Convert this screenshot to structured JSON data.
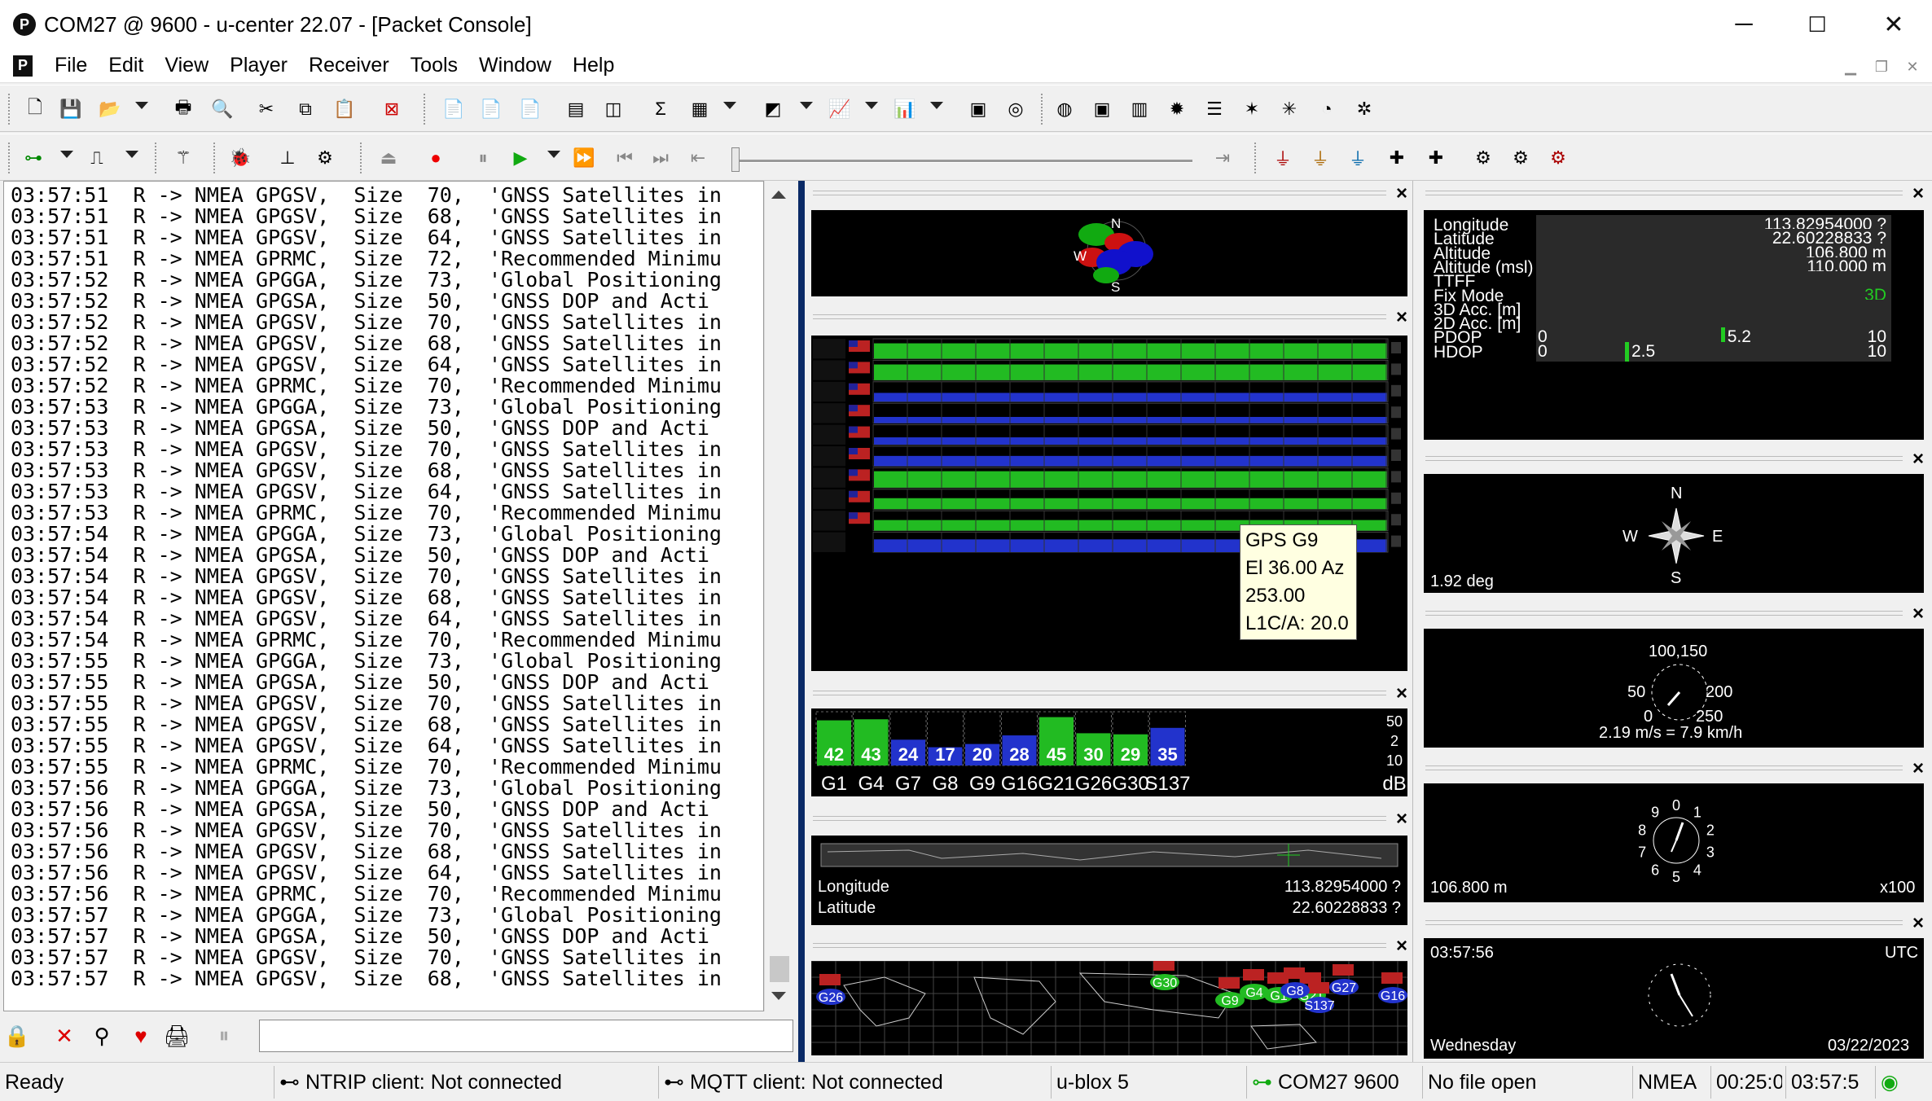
{
  "window": {
    "title": "COM27 @ 9600 - u-center 22.07 - [Packet Console]",
    "app_icon": "P",
    "minimize": "─",
    "maximize": "☐",
    "close": "✕"
  },
  "menu": {
    "doc_icon": "P",
    "items": [
      "File",
      "Edit",
      "View",
      "Player",
      "Receiver",
      "Tools",
      "Window",
      "Help"
    ]
  },
  "console": {
    "lines": [
      "03:57:51  R -> NMEA GPGSV,  Size  70,  'GNSS Satellites in",
      "03:57:51  R -> NMEA GPGSV,  Size  68,  'GNSS Satellites in",
      "03:57:51  R -> NMEA GPGSV,  Size  64,  'GNSS Satellites in",
      "03:57:51  R -> NMEA GPRMC,  Size  72,  'Recommended Minimu",
      "03:57:52  R -> NMEA GPGGA,  Size  73,  'Global Positioning",
      "03:57:52  R -> NMEA GPGSA,  Size  50,  'GNSS DOP and Acti",
      "03:57:52  R -> NMEA GPGSV,  Size  70,  'GNSS Satellites in",
      "03:57:52  R -> NMEA GPGSV,  Size  68,  'GNSS Satellites in",
      "03:57:52  R -> NMEA GPGSV,  Size  64,  'GNSS Satellites in",
      "03:57:52  R -> NMEA GPRMC,  Size  70,  'Recommended Minimu",
      "03:57:53  R -> NMEA GPGGA,  Size  73,  'Global Positioning",
      "03:57:53  R -> NMEA GPGSA,  Size  50,  'GNSS DOP and Acti",
      "03:57:53  R -> NMEA GPGSV,  Size  70,  'GNSS Satellites in",
      "03:57:53  R -> NMEA GPGSV,  Size  68,  'GNSS Satellites in",
      "03:57:53  R -> NMEA GPGSV,  Size  64,  'GNSS Satellites in",
      "03:57:53  R -> NMEA GPRMC,  Size  70,  'Recommended Minimu",
      "03:57:54  R -> NMEA GPGGA,  Size  73,  'Global Positioning",
      "03:57:54  R -> NMEA GPGSA,  Size  50,  'GNSS DOP and Acti",
      "03:57:54  R -> NMEA GPGSV,  Size  70,  'GNSS Satellites in",
      "03:57:54  R -> NMEA GPGSV,  Size  68,  'GNSS Satellites in",
      "03:57:54  R -> NMEA GPGSV,  Size  64,  'GNSS Satellites in",
      "03:57:54  R -> NMEA GPRMC,  Size  70,  'Recommended Minimu",
      "03:57:55  R -> NMEA GPGGA,  Size  73,  'Global Positioning",
      "03:57:55  R -> NMEA GPGSA,  Size  50,  'GNSS DOP and Acti",
      "03:57:55  R -> NMEA GPGSV,  Size  70,  'GNSS Satellites in",
      "03:57:55  R -> NMEA GPGSV,  Size  68,  'GNSS Satellites in",
      "03:57:55  R -> NMEA GPGSV,  Size  64,  'GNSS Satellites in",
      "03:57:55  R -> NMEA GPRMC,  Size  70,  'Recommended Minimu",
      "03:57:56  R -> NMEA GPGGA,  Size  73,  'Global Positioning",
      "03:57:56  R -> NMEA GPGSA,  Size  50,  'GNSS DOP and Acti",
      "03:57:56  R -> NMEA GPGSV,  Size  70,  'GNSS Satellites in",
      "03:57:56  R -> NMEA GPGSV,  Size  68,  'GNSS Satellites in",
      "03:57:56  R -> NMEA GPGSV,  Size  64,  'GNSS Satellites in",
      "03:57:56  R -> NMEA GPRMC,  Size  70,  'Recommended Minimu",
      "03:57:57  R -> NMEA GPGGA,  Size  73,  'Global Positioning",
      "03:57:57  R -> NMEA GPGSA,  Size  50,  'GNSS DOP and Acti",
      "03:57:57  R -> NMEA GPGSV,  Size  70,  'GNSS Satellites in",
      "03:57:57  R -> NMEA GPGSV,  Size  68,  'GNSS Satellites in"
    ]
  },
  "tooltip": {
    "lines": [
      "GPS G9",
      "El 36.00 Az",
      "253.00",
      "L1C/A: 20.0"
    ]
  },
  "sky_view": {
    "north": "N",
    "west": "W",
    "south": "S"
  },
  "signal_bars": {
    "labels": [
      "G1",
      "G4",
      "G7",
      "G8",
      "G9",
      "G16",
      "G21",
      "G26",
      "G30",
      "S137"
    ],
    "values": [
      42,
      43,
      24,
      17,
      20,
      28,
      45,
      30,
      29,
      35
    ],
    "used": [
      true,
      true,
      false,
      false,
      false,
      false,
      true,
      true,
      true,
      false
    ],
    "unit": "dB",
    "scale_top": "50",
    "scale_mid": "2",
    "scale_low": "10"
  },
  "position_strip": {
    "longitude_label": "Longitude",
    "longitude_value": "113.82954000 ?",
    "latitude_label": "Latitude",
    "latitude_value": "22.60228833 ?"
  },
  "world_map": {
    "sats": [
      "G26",
      "G30",
      "G9",
      "G4",
      "G1",
      "G21",
      "S137",
      "G27",
      "G16",
      "G8"
    ]
  },
  "data_panel": {
    "rows": [
      {
        "label": "Longitude",
        "value": "113.82954000 ?"
      },
      {
        "label": "Latitude",
        "value": "22.60228833 ?"
      },
      {
        "label": "Altitude",
        "value": "106.800 m"
      },
      {
        "label": "Altitude (msl)",
        "value": "110.000 m"
      },
      {
        "label": "TTFF",
        "value": ""
      },
      {
        "label": "Fix Mode",
        "value": "3D"
      },
      {
        "label": "3D Acc. [m]",
        "value": ""
      },
      {
        "label": "2D Acc. [m]",
        "value": ""
      },
      {
        "label": "PDOP",
        "value": "0",
        "marker": "5.2",
        "max": "10"
      },
      {
        "label": "HDOP",
        "value": "0",
        "marker": "2.5",
        "max": "10"
      }
    ],
    "pdop": 5.2,
    "hdop": 2.5,
    "fix_color": "#22cc22"
  },
  "compass": {
    "n": "N",
    "e": "E",
    "s": "S",
    "w": "W",
    "heading": "1.92 deg"
  },
  "speedometer": {
    "ticks_top": "100,150",
    "left": "50",
    "right": "200",
    "zero": "0",
    "right_low": "250",
    "readout": "2.19 m/s = 7.9 km/h"
  },
  "altimeter": {
    "numbers": [
      "0",
      "1",
      "2",
      "3",
      "4",
      "5",
      "6",
      "7",
      "8",
      "9"
    ],
    "readout": "106.800 m",
    "scale": "x100"
  },
  "clock": {
    "time": "03:57:56",
    "zone": "UTC",
    "day": "Wednesday",
    "date": "03/22/2023"
  },
  "statusbar": {
    "ready": "Ready",
    "ntrip": "NTRIP client: Not connected",
    "mqtt": "MQTT client: Not connected",
    "receiver": "u-blox 5",
    "port": "COM27 9600",
    "file": "No file open",
    "protocol": "NMEA",
    "elapsed": "00:25:0",
    "clock": "03:57:5"
  },
  "colors": {
    "signal_used": "#22bb22",
    "signal_unused": "#2233cc",
    "view_bg": "#000000",
    "splitter": "#0a2a66"
  }
}
